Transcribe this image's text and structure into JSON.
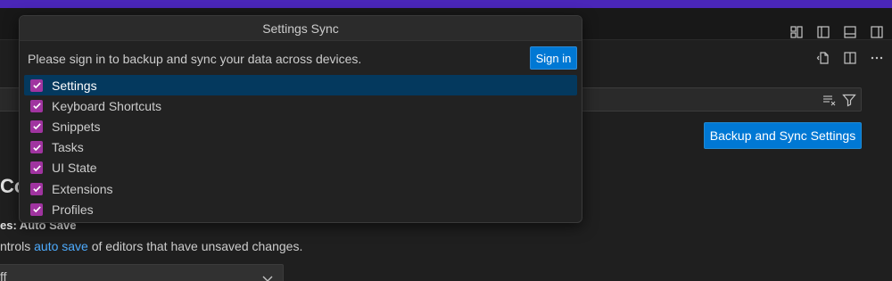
{
  "dialog": {
    "title": "Settings Sync",
    "message": "Please sign in to backup and sync your data across devices.",
    "signin_label": "Sign in",
    "items": [
      {
        "label": "Settings",
        "checked": true,
        "selected": true
      },
      {
        "label": "Keyboard Shortcuts",
        "checked": true
      },
      {
        "label": "Snippets",
        "checked": true
      },
      {
        "label": "Tasks",
        "checked": true
      },
      {
        "label": "UI State",
        "checked": true
      },
      {
        "label": "Extensions",
        "checked": true
      },
      {
        "label": "Profiles",
        "checked": true
      }
    ]
  },
  "titlebar": {
    "icons": [
      "customize-layout-icon",
      "toggle-primary-sidebar-icon",
      "toggle-panel-icon",
      "toggle-secondary-sidebar-icon"
    ]
  },
  "editor_actions": {
    "icons": [
      "open-settings-json-icon",
      "split-editor-icon",
      "more-actions-icon"
    ]
  },
  "search": {
    "icons": [
      "clear-filter-icon",
      "filter-icon"
    ]
  },
  "backup_button_label": "Backup and Sync Settings",
  "settings": {
    "section_heading": "Cor",
    "setting_title": "es: Auto Save",
    "desc_prefix": "ntrols ",
    "desc_link": "auto save",
    "desc_suffix": " of editors that have unsaved changes.",
    "dropdown_value": "ff"
  },
  "colors": {
    "accent": "#0078d4",
    "checkbox": "#a034a0",
    "selection": "#04395e",
    "top_strip": "#4a26b8",
    "link": "#4daafc"
  }
}
